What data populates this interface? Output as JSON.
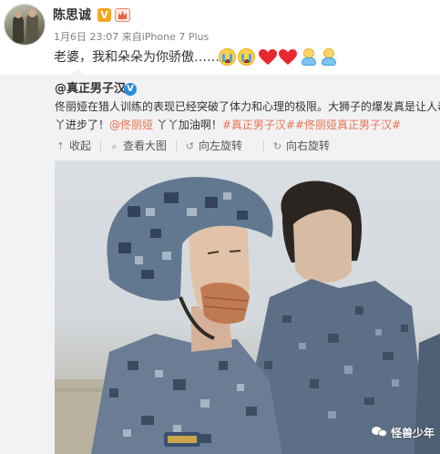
{
  "post": {
    "author": "陈思诚",
    "verified_badge": "V",
    "date": "1月6日 23:07",
    "source_prefix": "来自",
    "source": "iPhone 7 Plus",
    "text": "老婆，我和朵朵为你骄傲……",
    "emojis": [
      "crying-face-icon",
      "crying-face-icon",
      "heart-icon",
      "heart-icon",
      "baby-icon",
      "baby-icon"
    ]
  },
  "repost": {
    "author": "@真正男子汉",
    "verified_badge": "V",
    "line1": "佟丽娅在猎人训练的表现已经突破了体力和心理的极限。大狮子的爆发真是让人毒",
    "line2_start": "丫进步了！",
    "mention1": "@佟丽娅",
    "line2_mid": " 丫丫加油啊！",
    "tag1": "#真正男子汉#",
    "tag2": "#佟丽娅真正男子汉#",
    "actions": [
      {
        "icon": "collapse-icon",
        "label": "收起"
      },
      {
        "icon": "zoom-icon",
        "label": "查看大图"
      },
      {
        "icon": "rotate-left-icon",
        "label": "向左旋转"
      },
      {
        "icon": "rotate-right-icon",
        "label": "向右旋转"
      }
    ]
  },
  "photo": {
    "watermark": "怪兽少年"
  },
  "colors": {
    "link": "#eb7350",
    "repost_bg": "#f2f2f5",
    "text": "#333333",
    "meta": "#808080"
  }
}
